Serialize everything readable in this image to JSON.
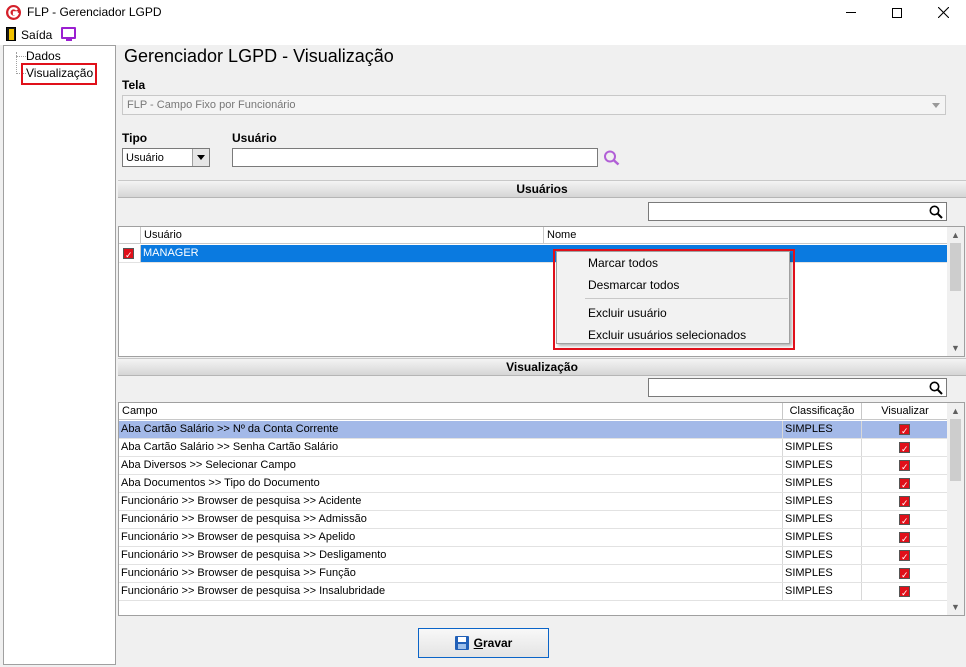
{
  "window": {
    "title": "FLP - Gerenciador LGPD"
  },
  "menu": {
    "exit_label": "Saída"
  },
  "tree": {
    "items": [
      "Dados",
      "Visualização"
    ],
    "selected": "Visualização"
  },
  "page": {
    "title": "Gerenciador LGPD - Visualização"
  },
  "tela": {
    "label": "Tela",
    "value": "FLP - Campo Fixo por Funcionário"
  },
  "tipo": {
    "label": "Tipo",
    "value": "Usuário"
  },
  "usuario": {
    "label": "Usuário",
    "value": ""
  },
  "users_section": {
    "title": "Usuários",
    "columns": [
      "Usuário",
      "Nome"
    ],
    "rows": [
      {
        "checked": true,
        "usuario": "MANAGER",
        "nome": ""
      }
    ]
  },
  "context_menu": {
    "items": [
      "Marcar todos",
      "Desmarcar todos",
      "Excluir usuário",
      "Excluir usuários selecionados"
    ]
  },
  "view_section": {
    "title": "Visualização",
    "columns": [
      "Campo",
      "Classificação",
      "Visualizar"
    ],
    "rows": [
      {
        "campo": "Aba Cartão Salário >> Nº da Conta Corrente",
        "classificacao": "SIMPLES",
        "visualizar": true
      },
      {
        "campo": "Aba Cartão Salário >> Senha Cartão Salário",
        "classificacao": "SIMPLES",
        "visualizar": true
      },
      {
        "campo": "Aba Diversos >> Selecionar Campo",
        "classificacao": "SIMPLES",
        "visualizar": true
      },
      {
        "campo": "Aba Documentos >> Tipo do Documento",
        "classificacao": "SIMPLES",
        "visualizar": true
      },
      {
        "campo": "Funcionário >> Browser de pesquisa >> Acidente",
        "classificacao": "SIMPLES",
        "visualizar": true
      },
      {
        "campo": "Funcionário >> Browser de pesquisa >> Admissão",
        "classificacao": "SIMPLES",
        "visualizar": true
      },
      {
        "campo": "Funcionário >> Browser de pesquisa >> Apelido",
        "classificacao": "SIMPLES",
        "visualizar": true
      },
      {
        "campo": "Funcionário >> Browser de pesquisa >> Desligamento",
        "classificacao": "SIMPLES",
        "visualizar": true
      },
      {
        "campo": "Funcionário >> Browser de pesquisa >> Função",
        "classificacao": "SIMPLES",
        "visualizar": true
      },
      {
        "campo": "Funcionário >> Browser de pesquisa >> Insalubridade",
        "classificacao": "SIMPLES",
        "visualizar": true
      }
    ]
  },
  "footer": {
    "save_prefix": "",
    "save_underlined": "G",
    "save_rest": "ravar"
  },
  "colors": {
    "accent_red": "#e0101a",
    "selection_blue": "#0a7ae0",
    "row_highlight": "#a3b9e8",
    "icon_purple": "#9b1fd1"
  }
}
